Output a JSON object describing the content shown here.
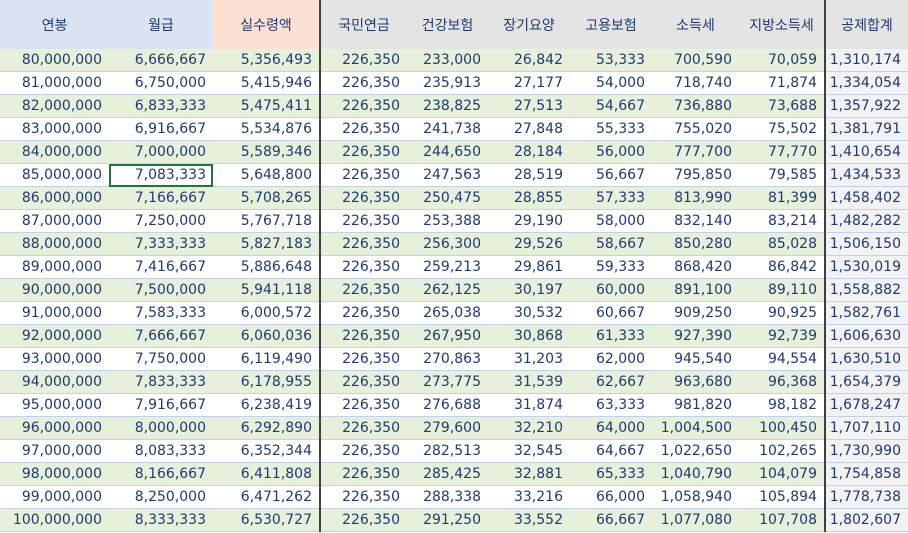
{
  "sheet": {
    "headers": [
      "연봉",
      "월급",
      "실수령액",
      "국민연금",
      "건강보험",
      "장기요양",
      "고용보험",
      "소득세",
      "지방소득세",
      "공제합계"
    ],
    "rows": [
      [
        "80,000,000",
        "6,666,667",
        "5,356,493",
        "226,350",
        "233,000",
        "26,842",
        "53,333",
        "700,590",
        "70,059",
        "1,310,174"
      ],
      [
        "81,000,000",
        "6,750,000",
        "5,415,946",
        "226,350",
        "235,913",
        "27,177",
        "54,000",
        "718,740",
        "71,874",
        "1,334,054"
      ],
      [
        "82,000,000",
        "6,833,333",
        "5,475,411",
        "226,350",
        "238,825",
        "27,513",
        "54,667",
        "736,880",
        "73,688",
        "1,357,922"
      ],
      [
        "83,000,000",
        "6,916,667",
        "5,534,876",
        "226,350",
        "241,738",
        "27,848",
        "55,333",
        "755,020",
        "75,502",
        "1,381,791"
      ],
      [
        "84,000,000",
        "7,000,000",
        "5,589,346",
        "226,350",
        "244,650",
        "28,184",
        "56,000",
        "777,700",
        "77,770",
        "1,410,654"
      ],
      [
        "85,000,000",
        "7,083,333",
        "5,648,800",
        "226,350",
        "247,563",
        "28,519",
        "56,667",
        "795,850",
        "79,585",
        "1,434,533"
      ],
      [
        "86,000,000",
        "7,166,667",
        "5,708,265",
        "226,350",
        "250,475",
        "28,855",
        "57,333",
        "813,990",
        "81,399",
        "1,458,402"
      ],
      [
        "87,000,000",
        "7,250,000",
        "5,767,718",
        "226,350",
        "253,388",
        "29,190",
        "58,000",
        "832,140",
        "83,214",
        "1,482,282"
      ],
      [
        "88,000,000",
        "7,333,333",
        "5,827,183",
        "226,350",
        "256,300",
        "29,526",
        "58,667",
        "850,280",
        "85,028",
        "1,506,150"
      ],
      [
        "89,000,000",
        "7,416,667",
        "5,886,648",
        "226,350",
        "259,213",
        "29,861",
        "59,333",
        "868,420",
        "86,842",
        "1,530,019"
      ],
      [
        "90,000,000",
        "7,500,000",
        "5,941,118",
        "226,350",
        "262,125",
        "30,197",
        "60,000",
        "891,100",
        "89,110",
        "1,558,882"
      ],
      [
        "91,000,000",
        "7,583,333",
        "6,000,572",
        "226,350",
        "265,038",
        "30,532",
        "60,667",
        "909,250",
        "90,925",
        "1,582,761"
      ],
      [
        "92,000,000",
        "7,666,667",
        "6,060,036",
        "226,350",
        "267,950",
        "30,868",
        "61,333",
        "927,390",
        "92,739",
        "1,606,630"
      ],
      [
        "93,000,000",
        "7,750,000",
        "6,119,490",
        "226,350",
        "270,863",
        "31,203",
        "62,000",
        "945,540",
        "94,554",
        "1,630,510"
      ],
      [
        "94,000,000",
        "7,833,333",
        "6,178,955",
        "226,350",
        "273,775",
        "31,539",
        "62,667",
        "963,680",
        "96,368",
        "1,654,379"
      ],
      [
        "95,000,000",
        "7,916,667",
        "6,238,419",
        "226,350",
        "276,688",
        "31,874",
        "63,333",
        "981,820",
        "98,182",
        "1,678,247"
      ],
      [
        "96,000,000",
        "8,000,000",
        "6,292,890",
        "226,350",
        "279,600",
        "32,210",
        "64,000",
        "1,004,500",
        "100,450",
        "1,707,110"
      ],
      [
        "97,000,000",
        "8,083,333",
        "6,352,344",
        "226,350",
        "282,513",
        "32,545",
        "64,667",
        "1,022,650",
        "102,265",
        "1,730,990"
      ],
      [
        "98,000,000",
        "8,166,667",
        "6,411,808",
        "226,350",
        "285,425",
        "32,881",
        "65,333",
        "1,040,790",
        "104,079",
        "1,754,858"
      ],
      [
        "99,000,000",
        "8,250,000",
        "6,471,262",
        "226,350",
        "288,338",
        "33,216",
        "66,000",
        "1,058,940",
        "105,894",
        "1,778,738"
      ],
      [
        "100,000,000",
        "8,333,333",
        "6,530,727",
        "226,350",
        "291,250",
        "33,552",
        "66,667",
        "1,077,080",
        "107,708",
        "1,802,607"
      ]
    ],
    "selected_cell": {
      "row": 5,
      "col": 1
    },
    "colors": {
      "header_blue": "#d9e3f1",
      "header_pink": "#fbe1d4",
      "header_gray": "#e4e4e4",
      "band_green": "#e6f0da",
      "text": "#1f3a73",
      "selection": "#217346"
    }
  }
}
